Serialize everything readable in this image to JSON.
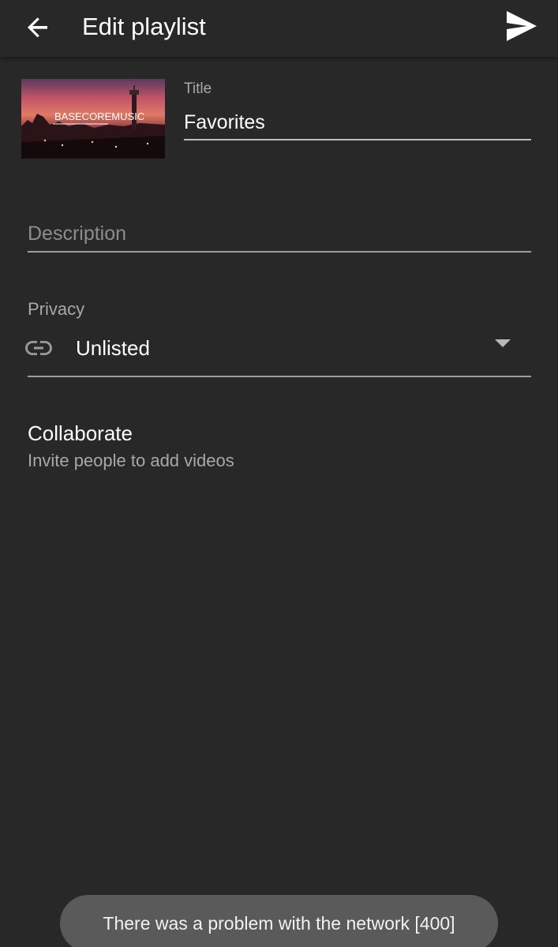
{
  "app_bar": {
    "title": "Edit playlist",
    "back_icon": "arrow-back-icon",
    "send_icon": "send-icon"
  },
  "thumbnail": {
    "overlay_text": "BASECOREMUSIC"
  },
  "form": {
    "title_label": "Title",
    "title_value": "Favorites",
    "description_placeholder": "Description",
    "description_value": "",
    "privacy_label": "Privacy",
    "privacy_value": "Unlisted",
    "privacy_icon": "link-icon"
  },
  "collaborate": {
    "title": "Collaborate",
    "subtitle": "Invite people to add videos"
  },
  "toast": {
    "message": "There was a problem with the network [400]"
  },
  "colors": {
    "background": "#282828",
    "text_primary": "#ffffff",
    "text_secondary": "#a8a8a8",
    "toast_background": "#5a5a5a"
  }
}
